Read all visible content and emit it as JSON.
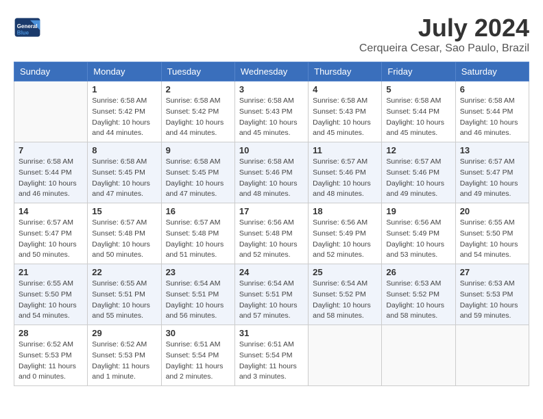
{
  "header": {
    "logo_general": "General",
    "logo_blue": "Blue",
    "month_title": "July 2024",
    "location": "Cerqueira Cesar, Sao Paulo, Brazil"
  },
  "weekdays": [
    "Sunday",
    "Monday",
    "Tuesday",
    "Wednesday",
    "Thursday",
    "Friday",
    "Saturday"
  ],
  "weeks": [
    [
      {
        "day": "",
        "info": ""
      },
      {
        "day": "1",
        "info": "Sunrise: 6:58 AM\nSunset: 5:42 PM\nDaylight: 10 hours\nand 44 minutes."
      },
      {
        "day": "2",
        "info": "Sunrise: 6:58 AM\nSunset: 5:42 PM\nDaylight: 10 hours\nand 44 minutes."
      },
      {
        "day": "3",
        "info": "Sunrise: 6:58 AM\nSunset: 5:43 PM\nDaylight: 10 hours\nand 45 minutes."
      },
      {
        "day": "4",
        "info": "Sunrise: 6:58 AM\nSunset: 5:43 PM\nDaylight: 10 hours\nand 45 minutes."
      },
      {
        "day": "5",
        "info": "Sunrise: 6:58 AM\nSunset: 5:44 PM\nDaylight: 10 hours\nand 45 minutes."
      },
      {
        "day": "6",
        "info": "Sunrise: 6:58 AM\nSunset: 5:44 PM\nDaylight: 10 hours\nand 46 minutes."
      }
    ],
    [
      {
        "day": "7",
        "info": "Sunrise: 6:58 AM\nSunset: 5:44 PM\nDaylight: 10 hours\nand 46 minutes."
      },
      {
        "day": "8",
        "info": "Sunrise: 6:58 AM\nSunset: 5:45 PM\nDaylight: 10 hours\nand 47 minutes."
      },
      {
        "day": "9",
        "info": "Sunrise: 6:58 AM\nSunset: 5:45 PM\nDaylight: 10 hours\nand 47 minutes."
      },
      {
        "day": "10",
        "info": "Sunrise: 6:58 AM\nSunset: 5:46 PM\nDaylight: 10 hours\nand 48 minutes."
      },
      {
        "day": "11",
        "info": "Sunrise: 6:57 AM\nSunset: 5:46 PM\nDaylight: 10 hours\nand 48 minutes."
      },
      {
        "day": "12",
        "info": "Sunrise: 6:57 AM\nSunset: 5:46 PM\nDaylight: 10 hours\nand 49 minutes."
      },
      {
        "day": "13",
        "info": "Sunrise: 6:57 AM\nSunset: 5:47 PM\nDaylight: 10 hours\nand 49 minutes."
      }
    ],
    [
      {
        "day": "14",
        "info": "Sunrise: 6:57 AM\nSunset: 5:47 PM\nDaylight: 10 hours\nand 50 minutes."
      },
      {
        "day": "15",
        "info": "Sunrise: 6:57 AM\nSunset: 5:48 PM\nDaylight: 10 hours\nand 50 minutes."
      },
      {
        "day": "16",
        "info": "Sunrise: 6:57 AM\nSunset: 5:48 PM\nDaylight: 10 hours\nand 51 minutes."
      },
      {
        "day": "17",
        "info": "Sunrise: 6:56 AM\nSunset: 5:48 PM\nDaylight: 10 hours\nand 52 minutes."
      },
      {
        "day": "18",
        "info": "Sunrise: 6:56 AM\nSunset: 5:49 PM\nDaylight: 10 hours\nand 52 minutes."
      },
      {
        "day": "19",
        "info": "Sunrise: 6:56 AM\nSunset: 5:49 PM\nDaylight: 10 hours\nand 53 minutes."
      },
      {
        "day": "20",
        "info": "Sunrise: 6:55 AM\nSunset: 5:50 PM\nDaylight: 10 hours\nand 54 minutes."
      }
    ],
    [
      {
        "day": "21",
        "info": "Sunrise: 6:55 AM\nSunset: 5:50 PM\nDaylight: 10 hours\nand 54 minutes."
      },
      {
        "day": "22",
        "info": "Sunrise: 6:55 AM\nSunset: 5:51 PM\nDaylight: 10 hours\nand 55 minutes."
      },
      {
        "day": "23",
        "info": "Sunrise: 6:54 AM\nSunset: 5:51 PM\nDaylight: 10 hours\nand 56 minutes."
      },
      {
        "day": "24",
        "info": "Sunrise: 6:54 AM\nSunset: 5:51 PM\nDaylight: 10 hours\nand 57 minutes."
      },
      {
        "day": "25",
        "info": "Sunrise: 6:54 AM\nSunset: 5:52 PM\nDaylight: 10 hours\nand 58 minutes."
      },
      {
        "day": "26",
        "info": "Sunrise: 6:53 AM\nSunset: 5:52 PM\nDaylight: 10 hours\nand 58 minutes."
      },
      {
        "day": "27",
        "info": "Sunrise: 6:53 AM\nSunset: 5:53 PM\nDaylight: 10 hours\nand 59 minutes."
      }
    ],
    [
      {
        "day": "28",
        "info": "Sunrise: 6:52 AM\nSunset: 5:53 PM\nDaylight: 11 hours\nand 0 minutes."
      },
      {
        "day": "29",
        "info": "Sunrise: 6:52 AM\nSunset: 5:53 PM\nDaylight: 11 hours\nand 1 minute."
      },
      {
        "day": "30",
        "info": "Sunrise: 6:51 AM\nSunset: 5:54 PM\nDaylight: 11 hours\nand 2 minutes."
      },
      {
        "day": "31",
        "info": "Sunrise: 6:51 AM\nSunset: 5:54 PM\nDaylight: 11 hours\nand 3 minutes."
      },
      {
        "day": "",
        "info": ""
      },
      {
        "day": "",
        "info": ""
      },
      {
        "day": "",
        "info": ""
      }
    ]
  ]
}
